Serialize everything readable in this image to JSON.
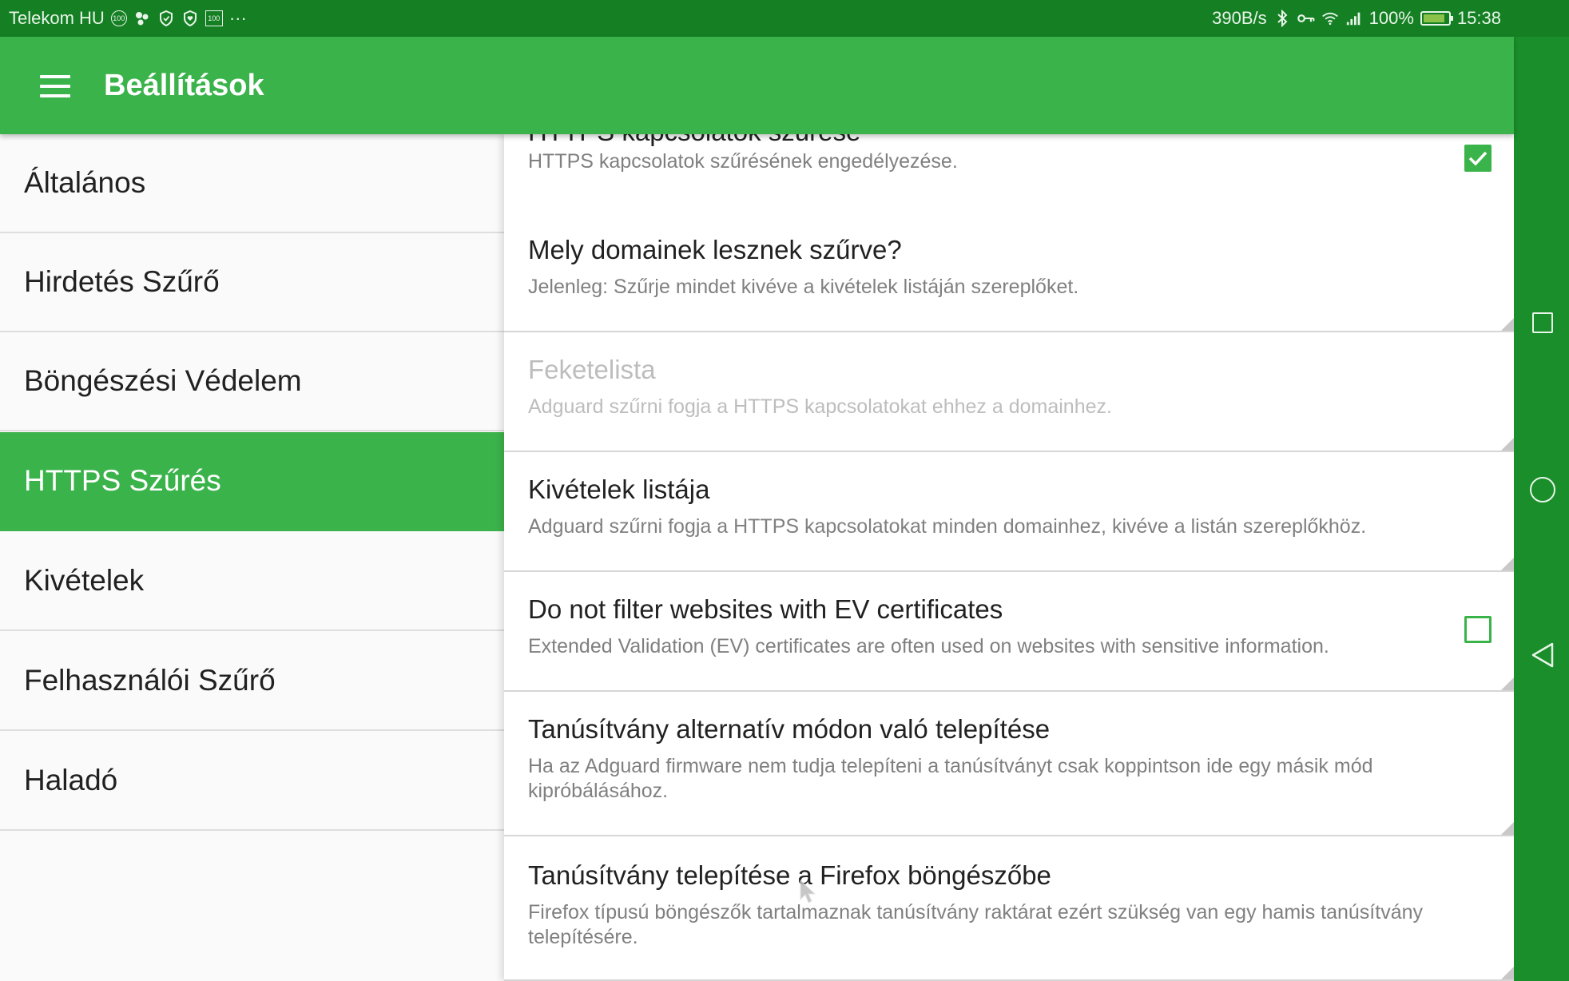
{
  "status_bar": {
    "carrier": "Telekom HU",
    "badge_100": "100",
    "box_100": "100",
    "more": "···",
    "net_speed": "390B/s",
    "battery": "100%",
    "time": "15:38"
  },
  "toolbar": {
    "title": "Beállítások",
    "menu_icon": "hamburger-menu-icon"
  },
  "sidebar": {
    "items": [
      {
        "label": "Általános",
        "active": false
      },
      {
        "label": "Hirdetés Szűrő",
        "active": false
      },
      {
        "label": "Böngészési Védelem",
        "active": false
      },
      {
        "label": "HTTPS Szűrés",
        "active": true
      },
      {
        "label": "Kivételek",
        "active": false
      },
      {
        "label": "Felhasználói Szűrő",
        "active": false
      },
      {
        "label": "Haladó",
        "active": false
      }
    ]
  },
  "settings": [
    {
      "title": "HTTPS kapcsolatok szűrése",
      "description": "HTTPS kapcsolatok szűrésének engedélyezése.",
      "checkbox": true,
      "checked": true,
      "enabled": true
    },
    {
      "title": "Mely domainek lesznek szűrve?",
      "description": "Jelenleg: Szűrje mindet kivéve a kivételek listáján szereplőket.",
      "checkbox": false,
      "enabled": true
    },
    {
      "title": "Feketelista",
      "description": "Adguard szűrni fogja a HTTPS kapcsolatokat ehhez a domainhez.",
      "checkbox": false,
      "enabled": false
    },
    {
      "title": "Kivételek listája",
      "description": "Adguard szűrni fogja a HTTPS kapcsolatokat minden domainhez, kivéve a listán szereplőkhöz.",
      "checkbox": false,
      "enabled": true
    },
    {
      "title": "Do not filter websites with EV certificates",
      "description": "Extended Validation (EV) certificates are often used on websites with sensitive information.",
      "checkbox": true,
      "checked": false,
      "enabled": true
    },
    {
      "title": "Tanúsítvány alternatív módon való telepítése",
      "description": "Ha az Adguard firmware nem tudja telepíteni a tanúsítványt csak koppintson ide egy másik mód kipróbálásához.",
      "checkbox": false,
      "enabled": true
    },
    {
      "title": "Tanúsítvány telepítése a Firefox böngészőbe",
      "description": "Firefox típusú böngészők tartalmaznak tanúsítvány raktárat ezért szükség van egy hamis tanúsítvány telepítésére.",
      "checkbox": false,
      "enabled": true
    }
  ],
  "colors": {
    "accent": "#3bb34b",
    "status_bar": "#157f24",
    "nav_bar": "#1a8e2a"
  }
}
